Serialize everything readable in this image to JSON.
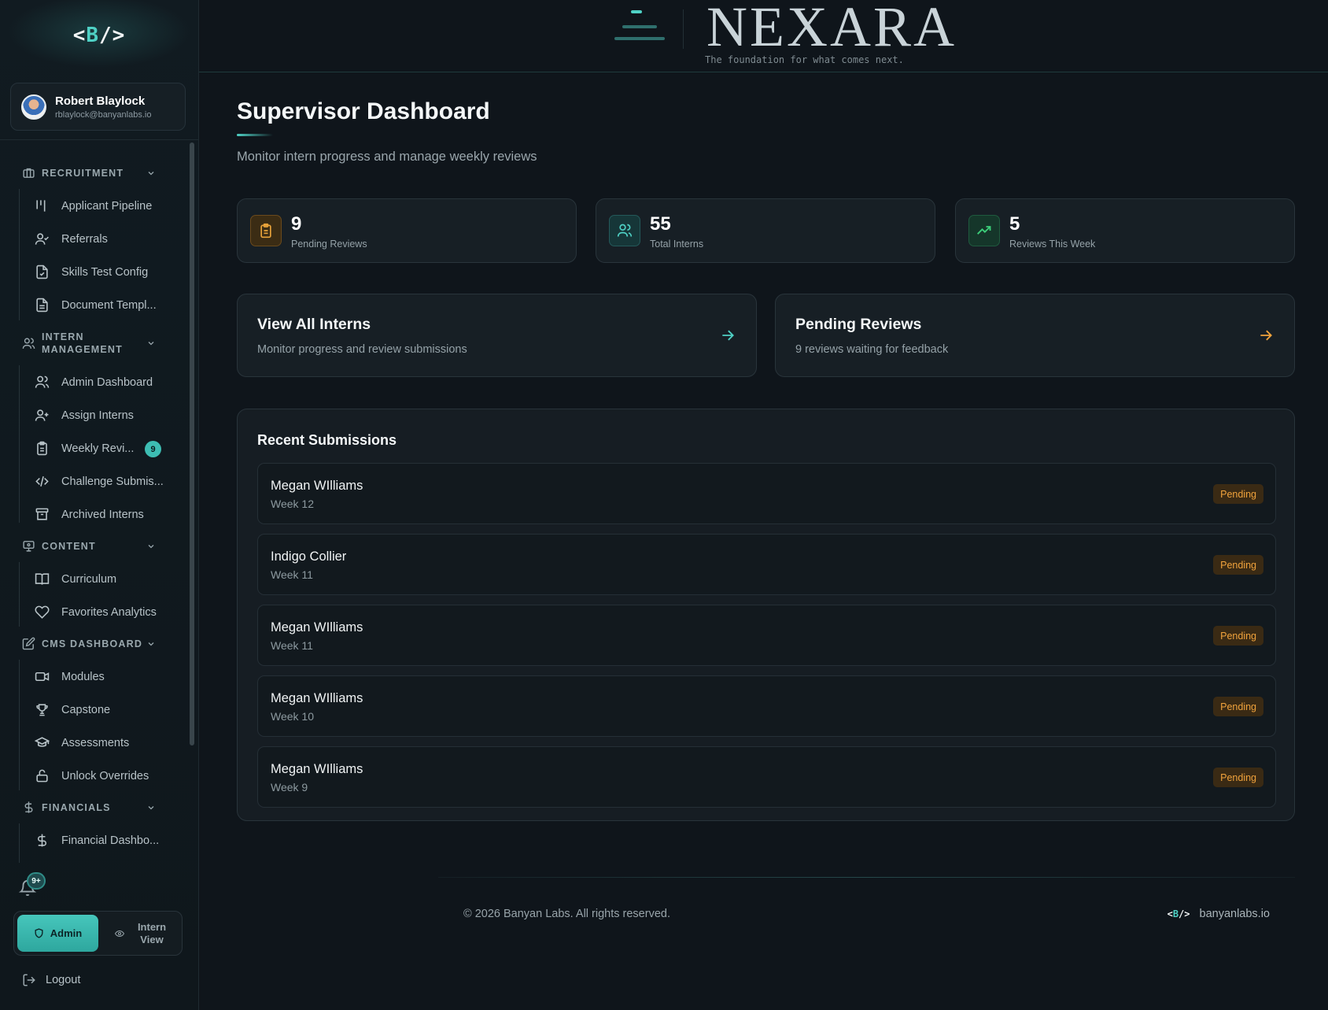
{
  "sidebar": {
    "logo": {
      "left": "<",
      "mid": "B",
      "right": "/>"
    },
    "user": {
      "name": "Robert Blaylock",
      "email": "rblaylock@banyanlabs.io"
    },
    "sections": [
      {
        "label": "RECRUITMENT",
        "icon": "briefcase-icon",
        "items": [
          {
            "label": "Applicant Pipeline",
            "icon": "pipeline-icon"
          },
          {
            "label": "Referrals",
            "icon": "user-check-icon"
          },
          {
            "label": "Skills Test Config",
            "icon": "file-check-icon"
          },
          {
            "label": "Document Templ...",
            "icon": "file-text-icon"
          }
        ]
      },
      {
        "label": "INTERN MANAGEMENT",
        "icon": "users-icon",
        "items": [
          {
            "label": "Admin Dashboard",
            "icon": "users-icon"
          },
          {
            "label": "Assign Interns",
            "icon": "user-plus-icon"
          },
          {
            "label": "Weekly Revi...",
            "icon": "clipboard-icon",
            "badge": "9"
          },
          {
            "label": "Challenge Submis...",
            "icon": "code-icon"
          },
          {
            "label": "Archived Interns",
            "icon": "archive-icon"
          }
        ]
      },
      {
        "label": "CONTENT",
        "icon": "monitor-icon",
        "items": [
          {
            "label": "Curriculum",
            "icon": "book-icon"
          },
          {
            "label": "Favorites Analytics",
            "icon": "heart-icon"
          }
        ]
      },
      {
        "label": "CMS DASHBOARD",
        "icon": "edit-icon",
        "items": [
          {
            "label": "Modules",
            "icon": "video-icon"
          },
          {
            "label": "Capstone",
            "icon": "trophy-icon"
          },
          {
            "label": "Assessments",
            "icon": "graduation-cap-icon"
          },
          {
            "label": "Unlock Overrides",
            "icon": "lock-icon"
          }
        ]
      },
      {
        "label": "FINANCIALS",
        "icon": "dollar-icon",
        "items": [
          {
            "label": "Financial Dashbo...",
            "icon": "dollar-icon"
          }
        ]
      }
    ],
    "notifications_badge": "9+",
    "mode": {
      "admin": "Admin",
      "intern": "Intern View"
    },
    "logout": "Logout"
  },
  "header": {
    "brand": "NEXARA",
    "tagline": "The foundation for what comes next."
  },
  "main": {
    "title": "Supervisor Dashboard",
    "subtitle": "Monitor intern progress and manage weekly reviews",
    "stats": [
      {
        "value": "9",
        "label": "Pending Reviews",
        "icon": "clipboard-icon",
        "color": "#e8a23a"
      },
      {
        "value": "55",
        "label": "Total Interns",
        "icon": "users-icon",
        "color": "#4fd1c5"
      },
      {
        "value": "5",
        "label": "Reviews This Week",
        "icon": "trending-up-icon",
        "color": "#3ccf7a"
      }
    ],
    "actions": [
      {
        "title": "View All Interns",
        "subtitle": "Monitor progress and review submissions",
        "arrow_color": "#4fd1c5"
      },
      {
        "title": "Pending Reviews",
        "subtitle": "9 reviews waiting for feedback",
        "arrow_color": "#f1a33c"
      }
    ],
    "recent": {
      "title": "Recent Submissions",
      "rows": [
        {
          "name": "Megan WIlliams",
          "week": "Week 12",
          "status": "Pending"
        },
        {
          "name": "Indigo Collier",
          "week": "Week 11",
          "status": "Pending"
        },
        {
          "name": "Megan WIlliams",
          "week": "Week 11",
          "status": "Pending"
        },
        {
          "name": "Megan WIlliams",
          "week": "Week 10",
          "status": "Pending"
        },
        {
          "name": "Megan WIlliams",
          "week": "Week 9",
          "status": "Pending"
        }
      ]
    }
  },
  "footer": {
    "copyright": "© 2026 Banyan Labs. All rights reserved.",
    "logo": {
      "left": "<",
      "mid": "B",
      "right": "/>"
    },
    "domain": "banyanlabs.io"
  }
}
